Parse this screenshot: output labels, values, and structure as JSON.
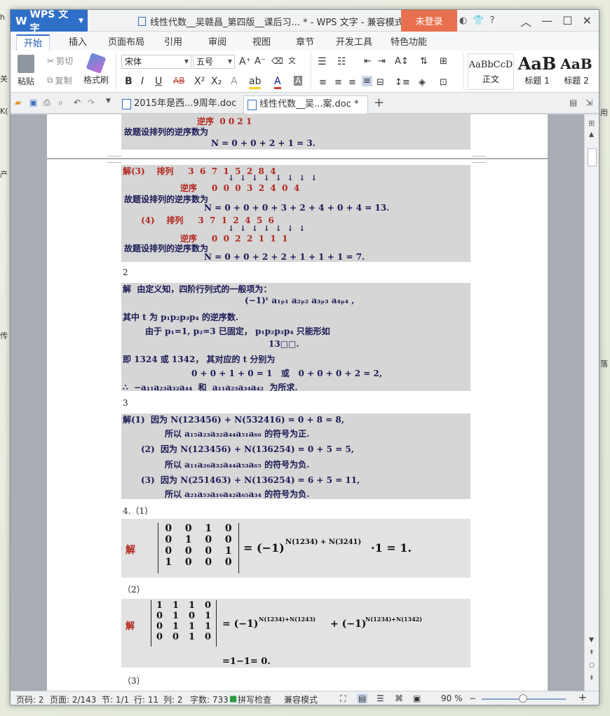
{
  "window": {
    "app_name": "WPS 文字",
    "doc_title": "线性代数__吴赣昌_第四版__课后习... * - WPS 文字 - 兼容模式",
    "login_label": "未登录",
    "help_label": "?"
  },
  "tabs": [
    "开始",
    "插入",
    "页面布局",
    "引用",
    "审阅",
    "视图",
    "章节",
    "开发工具",
    "特色功能"
  ],
  "ribbon": {
    "paste": "粘贴",
    "cut": "剪切",
    "copy": "复制",
    "format_painter": "格式刷",
    "font_name": "宋体",
    "font_size": "五号",
    "styles": [
      {
        "preview": "AaBbCcD",
        "label": "正文"
      },
      {
        "preview": "AaB",
        "label": "标题 1"
      },
      {
        "preview": "AaB",
        "label": "标题 2"
      }
    ]
  },
  "doc_tabs": [
    {
      "label": "2015年是西...9周年.doc"
    },
    {
      "label": "线性代数__吴...案.doc *"
    }
  ],
  "content": {
    "sec1": {
      "a": "逆序  0 0 2 1",
      "b": "故题设排列的逆序数为",
      "c": "N = 0 + 0 + 2 + 1 = 3."
    },
    "sec2": {
      "l1": "解(3)    排列     3  6  7  1  5  2  8  4",
      "l2": "↓  ↓  ↓  ↓  ↓  ↓  ↓  ↓",
      "l3": "逆序     0  0  0  3  2  4  0  4",
      "l4": "故题设排列的逆序数为",
      "l5": "N = 0 + 0 + 0 + 3 + 2 + 4 + 0 + 4 = 13.",
      "l6": "(4)    排列     3  7  1  2  4  5  6",
      "l7": "↓  ↓  ↓  ↓  ↓  ↓  ↓",
      "l8": "逆序     0  0  2  2  1  1  1",
      "l9": "故题设排列的逆序数为",
      "l10": "N = 0 + 0 + 2 + 2 + 1 + 1 + 1 = 7."
    },
    "label2": "2",
    "sec3": {
      "l1": "解  由定义知，四阶行列式的一般项为：",
      "l2": "(−1)ᵗ a₁ₚ₁ a₂ₚ₂ a₃ₚ₃ a₄ₚ₄ ,",
      "l3": "其中 t 为 p₁p₂p₃p₄ 的逆序数.",
      "l4": "由于 p₁=1, p₂=3 已固定， p₁p₂p₃p₄ 只能形如",
      "l5": "13□□.",
      "l6": "即 1324 或 1342， 其对应的 t 分别为",
      "l7": "0 + 0 + 1 + 0 = 1   或   0 + 0 + 0 + 2 = 2,",
      "l8": "∴  −a₁₁a₂₃a₃₂a₄₄  和  a₁₁a₂₃a₃₄a₄₂  为所求."
    },
    "label3": "3",
    "sec4": {
      "l1": "解(1)  因为 N(123456) + N(532416) = 0 + 8 = 8,",
      "l2": "所以 a₁₅a₂₃a₃₂a₄₄a₅₁a₆₆ 的符号为正.",
      "l3": "(2)  因为 N(123456) + N(136254) = 0 + 5 = 5,",
      "l4": "所以 a₁₁a₂₆a₃₂a₄₄a₅₃a₆₅ 的符号为负.",
      "l5": "(3)  因为 N(251463) + N(136254) = 6 + 5 = 11,",
      "l6": "所以 a₂₁a₅₃a₁₆a₄₂a₆₅a₃₄ 的符号为负."
    },
    "label4": "4.（1）",
    "sec5": {
      "jie": "解",
      "rows": [
        [
          "0",
          "0",
          "1",
          "0"
        ],
        [
          "0",
          "1",
          "0",
          "0"
        ],
        [
          "0",
          "0",
          "0",
          "1"
        ],
        [
          "1",
          "0",
          "0",
          "0"
        ]
      ],
      "eq": "= (−1)",
      "sup": "N(1234) + N(3241)",
      "tail": "·1 = 1."
    },
    "label5": "（2）",
    "sec6": {
      "jie": "解",
      "rows": [
        [
          "1",
          "1",
          "1",
          "0"
        ],
        [
          "0",
          "1",
          "0",
          "1"
        ],
        [
          "0",
          "1",
          "1",
          "1"
        ],
        [
          "0",
          "0",
          "1",
          "0"
        ]
      ],
      "eq": "= (−1)",
      "sup1": "N(1234)+N(1243)",
      "plus": "+ (−1)",
      "sup2": "N(1234)+N(1342)",
      "res": "=1−1= 0."
    },
    "label6": "（3）"
  },
  "status": {
    "page_code": "页码: 2",
    "pages": "页面: 2/143",
    "section": "节: 1/1",
    "row": "行: 11",
    "col": "列: 2",
    "words": "字数: 733",
    "spell": "拼写检查",
    "compat": "兼容模式",
    "zoom": "90 %"
  }
}
